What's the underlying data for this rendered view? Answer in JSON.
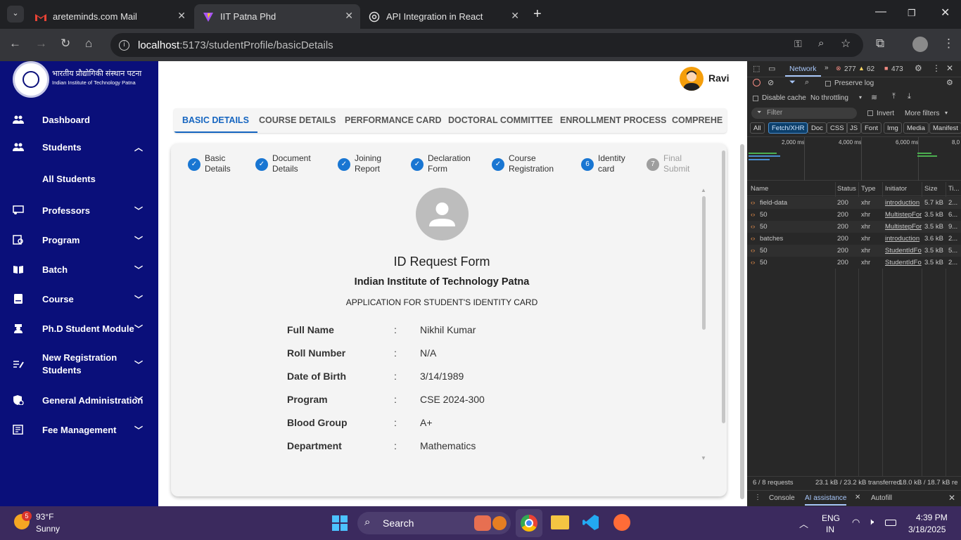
{
  "browser": {
    "tabs": [
      {
        "title": "areteminds.com Mail",
        "icon": "gmail-icon"
      },
      {
        "title": "IIT Patna Phd",
        "icon": "vite-icon",
        "active": true
      },
      {
        "title": "API Integration in React",
        "icon": "chatgpt-icon"
      }
    ],
    "url_host": "localhost",
    "url_path": ":5173/studentProfile/basicDetails"
  },
  "sidebar": {
    "brand_hindi": "भारतीय प्रौद्योगिकी संस्थान पटना",
    "brand_english": "Indian Institute of Technology Patna",
    "items": [
      {
        "label": "Dashboard",
        "icon": "people-icon"
      },
      {
        "label": "Students",
        "icon": "people-icon",
        "expanded": true
      },
      {
        "label": "All Students"
      },
      {
        "label": "Professors",
        "icon": "professor-icon"
      },
      {
        "label": "Program",
        "icon": "program-icon"
      },
      {
        "label": "Batch",
        "icon": "book-icon"
      },
      {
        "label": "Course",
        "icon": "course-icon"
      },
      {
        "label": "Ph.D Student Module",
        "icon": "graduate-icon"
      },
      {
        "label": "New Registration Students",
        "label_line1": "New Registration",
        "label_line2": "Students",
        "icon": "registration-icon"
      },
      {
        "label": "General Administration",
        "icon": "admin-icon"
      },
      {
        "label": "Fee Management",
        "icon": "fee-icon"
      }
    ]
  },
  "header": {
    "user_name": "Ravi"
  },
  "profile_tabs": [
    "BASIC DETAILS",
    "COURSE DETAILS",
    "PERFORMANCE CARD",
    "DOCTORAL COMMITTEE",
    "ENROLLMENT PROCESS",
    "COMPREHE"
  ],
  "steps": [
    {
      "line1": "Basic",
      "line2": "Details",
      "marker": "✓"
    },
    {
      "line1": "Document",
      "line2": "Details",
      "marker": "✓"
    },
    {
      "line1": "Joining",
      "line2": "Report",
      "marker": "✓"
    },
    {
      "line1": "Declaration",
      "line2": "Form",
      "marker": "✓"
    },
    {
      "line1": "Course",
      "line2": "Registration",
      "marker": "✓"
    },
    {
      "line1": "Identity",
      "line2": "card",
      "marker": "6"
    },
    {
      "line1": "Final",
      "line2": "Submit",
      "marker": "7"
    }
  ],
  "form": {
    "title": "ID Request Form",
    "institute": "Indian Institute of Technology Patna",
    "subtitle": "APPLICATION FOR STUDENT'S IDENTITY CARD",
    "separator": ":",
    "fields": [
      {
        "label": "Full Name",
        "value": "Nikhil Kumar"
      },
      {
        "label": "Roll Number",
        "value": "N/A"
      },
      {
        "label": "Date of Birth",
        "value": "3/14/1989"
      },
      {
        "label": "Program",
        "value": "CSE 2024-300"
      },
      {
        "label": "Blood Group",
        "value": "A+"
      },
      {
        "label": "Department",
        "value": "Mathematics"
      }
    ]
  },
  "devtools": {
    "panel": "Network",
    "errors": "277",
    "warnings": "62",
    "messages": "473",
    "preserve_log": "Preserve log",
    "disable_cache": "Disable cache",
    "throttling": "No throttling",
    "filter_placeholder": "Filter",
    "invert": "Invert",
    "more_filters": "More filters",
    "filters": [
      "All",
      "Fetch/XHR",
      "Doc",
      "CSS",
      "JS",
      "Font",
      "Img",
      "Media",
      "Manifest"
    ],
    "timeline": [
      "2,000 ms",
      "4,000 ms",
      "6,000 ms",
      "8,0"
    ],
    "columns": [
      "Name",
      "Status",
      "Type",
      "Initiator",
      "Size",
      "Ti..."
    ],
    "requests": [
      {
        "name": "field-data",
        "status": "200",
        "type": "xhr",
        "initiator": "introduction",
        "size": "5.7 kB",
        "time": "2..."
      },
      {
        "name": "50",
        "status": "200",
        "type": "xhr",
        "initiator": "MultistepFor",
        "size": "3.5 kB",
        "time": "6..."
      },
      {
        "name": "50",
        "status": "200",
        "type": "xhr",
        "initiator": "MultistepFor",
        "size": "3.5 kB",
        "time": "9..."
      },
      {
        "name": "batches",
        "status": "200",
        "type": "xhr",
        "initiator": "introduction",
        "size": "3.6 kB",
        "time": "2..."
      },
      {
        "name": "50",
        "status": "200",
        "type": "xhr",
        "initiator": "StudentIdFo",
        "size": "3.5 kB",
        "time": "5..."
      },
      {
        "name": "50",
        "status": "200",
        "type": "xhr",
        "initiator": "StudentIdFo",
        "size": "3.5 kB",
        "time": "2..."
      }
    ],
    "summary_requests": "6 / 8 requests",
    "summary_transferred": "23.1 kB / 23.2 kB transferred",
    "summary_resources": "18.0 kB / 18.7 kB re",
    "drawer_tabs": [
      "Console",
      "AI assistance",
      "Autofill"
    ]
  },
  "taskbar": {
    "weather_badge": "5",
    "temperature": "93°F",
    "condition": "Sunny",
    "search": "Search",
    "lang1": "ENG",
    "lang2": "IN",
    "time": "4:39 PM",
    "date": "3/18/2025"
  }
}
